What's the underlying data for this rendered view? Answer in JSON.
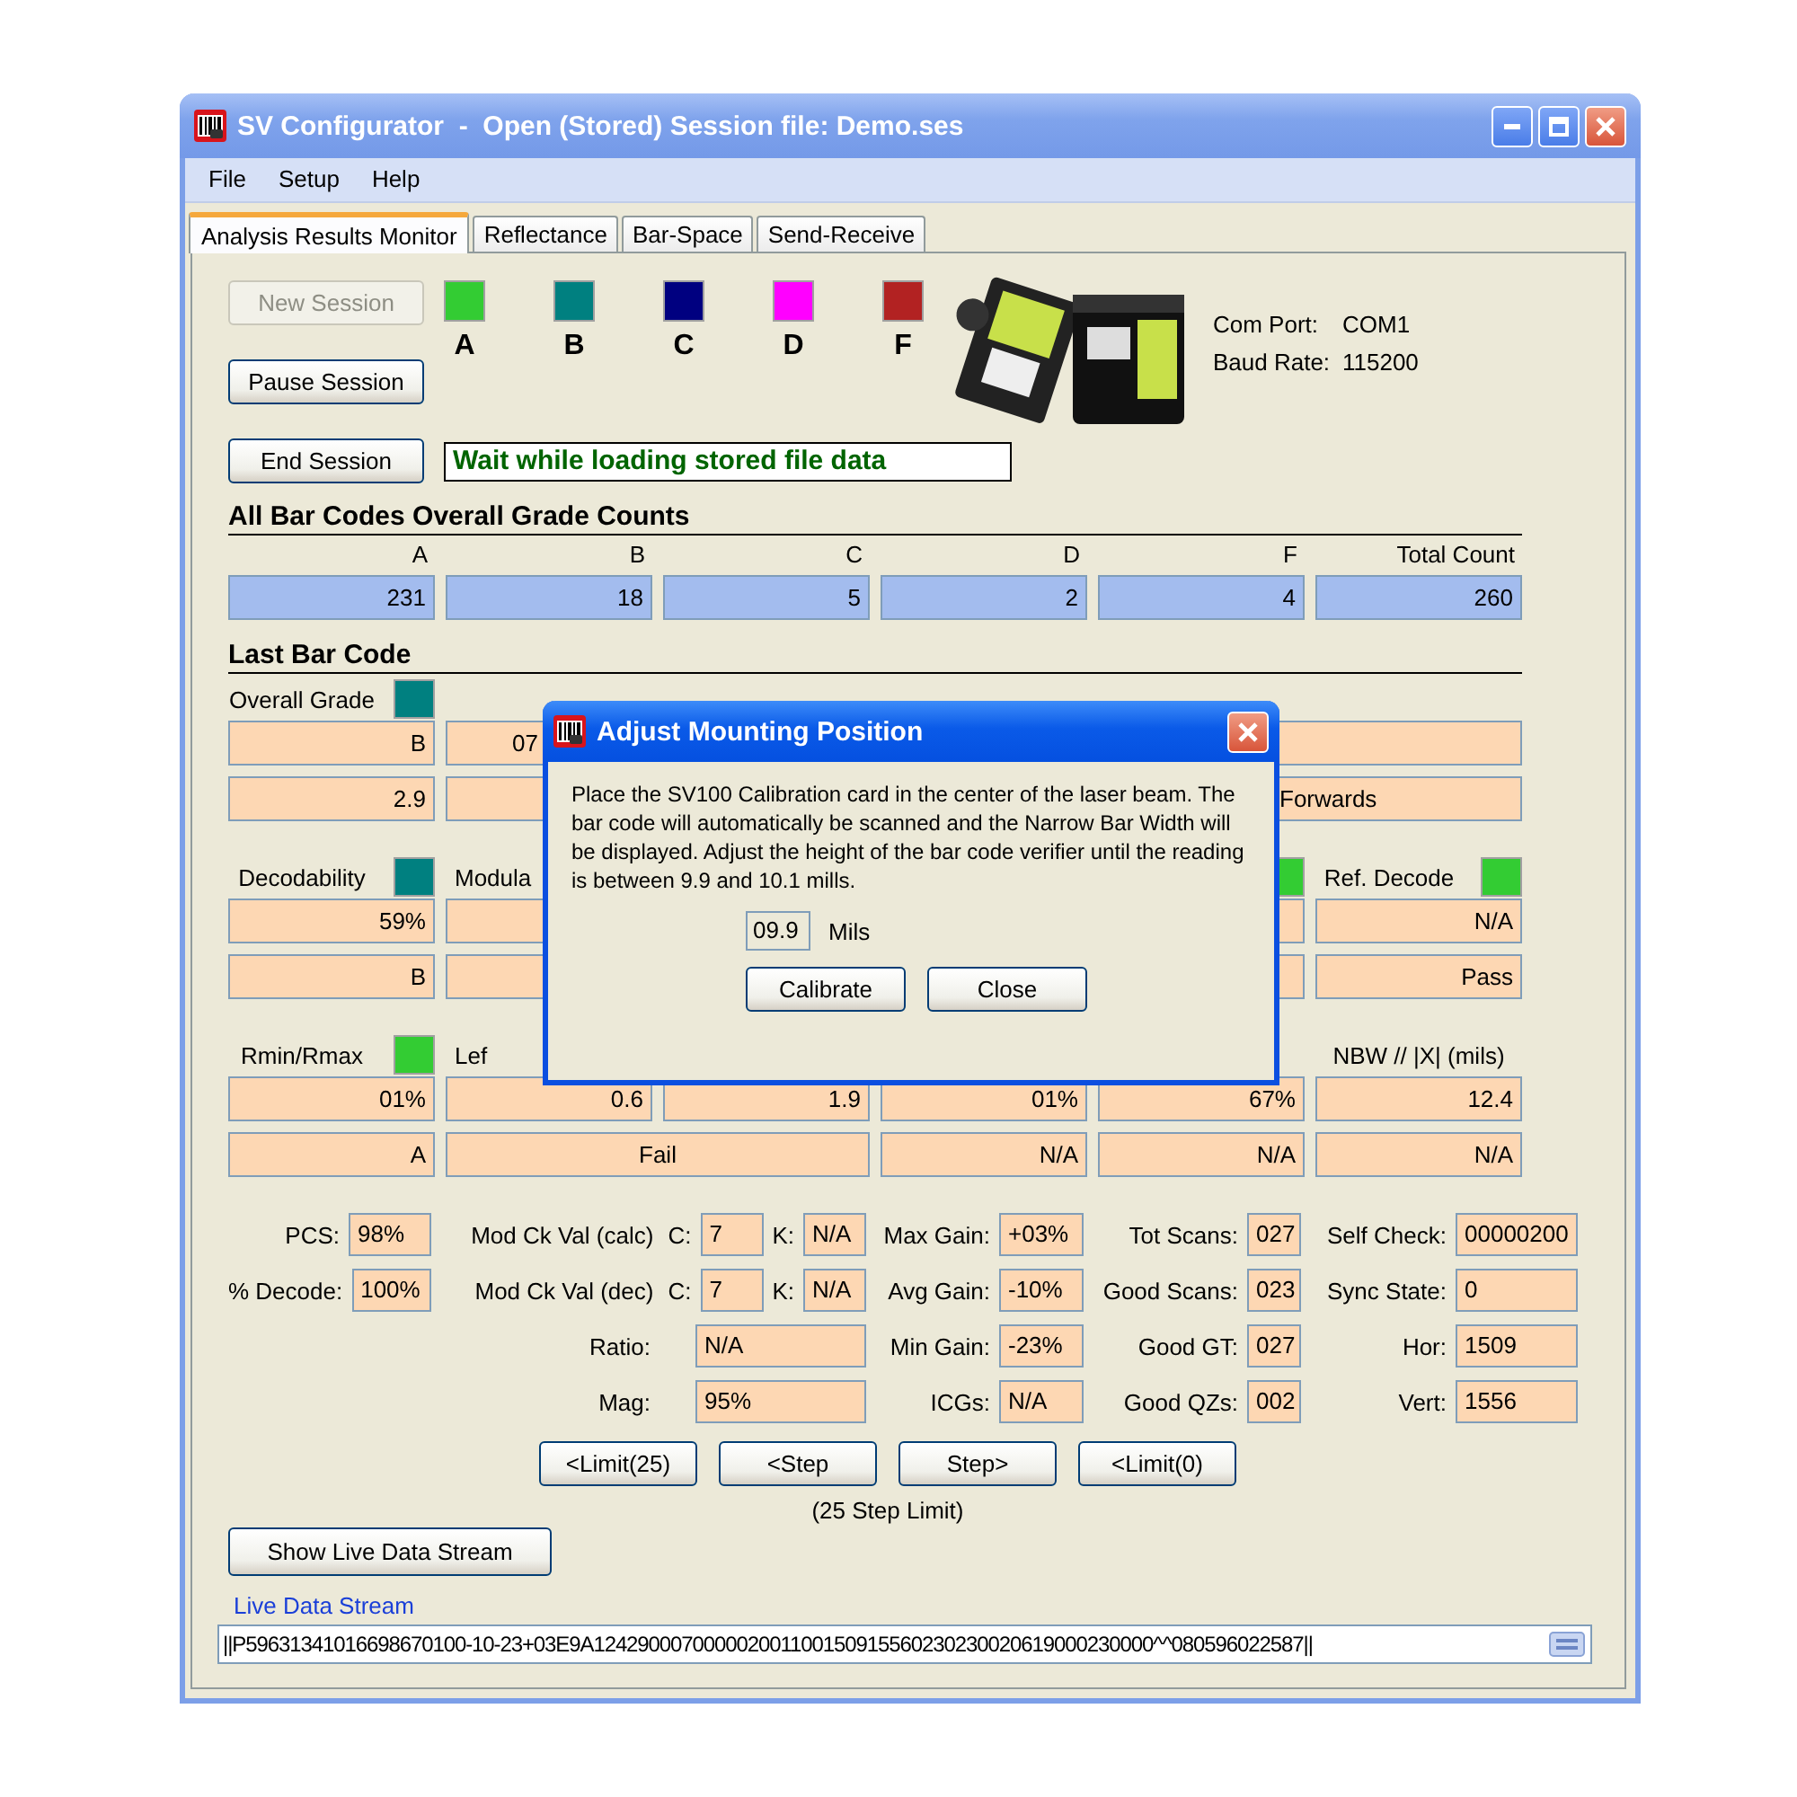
{
  "window": {
    "title": "SV Configurator  -  Open (Stored) Session file: Demo.ses"
  },
  "menu": [
    "File",
    "Setup",
    "Help"
  ],
  "tabs": [
    {
      "label": "Analysis Results Monitor",
      "selected": true
    },
    {
      "label": "Reflectance",
      "selected": false
    },
    {
      "label": "Bar-Space",
      "selected": false
    },
    {
      "label": "Send-Receive",
      "selected": false
    }
  ],
  "session": {
    "buttons": [
      {
        "label": "New Session",
        "disabled": true
      },
      {
        "label": "Pause Session",
        "disabled": false
      },
      {
        "label": "End Session",
        "disabled": false
      }
    ],
    "status": "Wait while loading stored file data"
  },
  "grade_legend": [
    {
      "label": "A",
      "color": "#33cc33"
    },
    {
      "label": "B",
      "color": "#008080"
    },
    {
      "label": "C",
      "color": "#000080"
    },
    {
      "label": "D",
      "color": "#ff00ff"
    },
    {
      "label": "F",
      "color": "#b22222"
    }
  ],
  "connection": [
    {
      "label": "Com Port:",
      "value": "COM1"
    },
    {
      "label": "Baud Rate:",
      "value": "115200"
    }
  ],
  "grade_counts": {
    "title": "All Bar Codes Overall Grade Counts",
    "columns": [
      {
        "label": "A",
        "value": "231"
      },
      {
        "label": "B",
        "value": "18"
      },
      {
        "label": "C",
        "value": "5"
      },
      {
        "label": "D",
        "value": "2"
      },
      {
        "label": "F",
        "value": "4"
      },
      {
        "label": "Total Count",
        "value": "260"
      }
    ]
  },
  "last_bar_code": {
    "title": "Last Bar Code",
    "groups": [
      {
        "headers": [
          {
            "label": "Overall Grade",
            "color": "#008080"
          },
          {
            "kind": "blank"
          },
          {
            "kind": "blank"
          },
          {
            "kind": "blank"
          },
          {
            "kind": "blank"
          },
          {
            "kind": "blank"
          }
        ],
        "rows": [
          [
            {
              "kind": "num",
              "value": "B"
            },
            {
              "kind": "clip",
              "value": "07"
            },
            {
              "kind": "blank"
            },
            {
              "kind": "blank"
            },
            {
              "kind": "wide"
            },
            {
              "kind": "merged"
            }
          ],
          [
            {
              "kind": "num",
              "value": "2.9"
            },
            {
              "kind": "blank"
            },
            {
              "kind": "blank"
            },
            {
              "kind": "blank"
            },
            {
              "kind": "wide_clip",
              "value": "Forwards"
            },
            {
              "kind": "merged"
            }
          ]
        ]
      },
      {
        "headers": [
          {
            "label": "Decodability",
            "color": "#008080"
          },
          {
            "label": "Modula",
            "kind": "clip"
          },
          {
            "kind": "blank"
          },
          {
            "kind": "blank"
          },
          {
            "color": "#33cc33"
          },
          {
            "label": "Ref. Decode",
            "color": "#33cc33"
          }
        ],
        "rows": [
          [
            {
              "kind": "num",
              "value": "59%"
            },
            {
              "kind": "blank"
            },
            {
              "kind": "blank"
            },
            {
              "kind": "blank"
            },
            {
              "kind": "blank"
            },
            {
              "kind": "num",
              "value": "N/A"
            }
          ],
          [
            {
              "kind": "num",
              "value": "B"
            },
            {
              "kind": "blank"
            },
            {
              "kind": "blank"
            },
            {
              "kind": "blank"
            },
            {
              "kind": "blank"
            },
            {
              "kind": "num",
              "value": "Pass"
            }
          ]
        ]
      },
      {
        "headers": [
          {
            "label": "Rmin/Rmax",
            "color": "#33cc33"
          },
          {
            "label": "Lef",
            "kind": "clip"
          },
          {
            "kind": "blank"
          },
          {
            "kind": "blank"
          },
          {
            "kind": "blank"
          },
          {
            "label": "NBW // |X| (mils)"
          }
        ],
        "rows": [
          [
            {
              "kind": "num",
              "value": "01%"
            },
            {
              "kind": "num",
              "value": "0.6"
            },
            {
              "kind": "num",
              "value": "1.9"
            },
            {
              "kind": "num",
              "value": "01%"
            },
            {
              "kind": "num",
              "value": "67%"
            },
            {
              "kind": "num",
              "value": "12.4"
            }
          ],
          [
            {
              "kind": "num",
              "value": "A"
            },
            {
              "kind": "wide",
              "value": "Fail"
            },
            {
              "kind": "merged"
            },
            {
              "kind": "num",
              "value": "N/A"
            },
            {
              "kind": "num",
              "value": "N/A"
            },
            {
              "kind": "num",
              "value": "N/A"
            }
          ]
        ]
      }
    ]
  },
  "stats": [
    [
      {
        "label": "PCS:",
        "value": "98%"
      },
      {
        "kind": "check",
        "label": "Mod Ck Val (calc)",
        "c_label": "C:",
        "c_value": "7",
        "k_label": "K:",
        "k_value": "N/A"
      },
      {
        "label": "Max Gain:",
        "value": "+03%"
      },
      {
        "label": "Tot Scans:",
        "value": "027"
      },
      {
        "label": "Self Check:",
        "value": "00000200"
      }
    ],
    [
      {
        "label": "% Decode:",
        "value": "100%"
      },
      {
        "kind": "check",
        "label": "Mod Ck Val (dec)",
        "c_label": "C:",
        "c_value": "7",
        "k_label": "K:",
        "k_value": "N/A"
      },
      {
        "label": "Avg Gain:",
        "value": "-10%"
      },
      {
        "label": "Good Scans:",
        "value": "023"
      },
      {
        "label": "Sync State:",
        "value": "0"
      }
    ],
    [
      {
        "kind": "blank"
      },
      {
        "label": "Ratio:",
        "value": "N/A"
      },
      {
        "label": "Min Gain:",
        "value": "-23%"
      },
      {
        "label": "Good GT:",
        "value": "027"
      },
      {
        "label": "Hor:",
        "value": "1509"
      }
    ],
    [
      {
        "kind": "blank"
      },
      {
        "label": "Mag:",
        "value": "95%"
      },
      {
        "label": "ICGs:",
        "value": "N/A"
      },
      {
        "label": "Good QZs:",
        "value": "002"
      },
      {
        "label": "Vert:",
        "value": "1556"
      }
    ]
  ],
  "step_buttons": [
    "<Limit(25)",
    "<Step",
    "Step>",
    "<Limit(0)"
  ],
  "step_note": "(25 Step Limit)",
  "live_stream": {
    "button": "Show Live Data Stream",
    "label": "Live Data Stream",
    "value": "||P59631341016698670100-10-23+03E9A124290007000002001100150915560230230020619000230000^^080596022587||"
  },
  "dialog": {
    "title": "Adjust Mounting Position",
    "message": "Place the SV100 Calibration card in the center of the laser beam. The bar code will automatically be scanned and the Narrow Bar Width will be displayed. Adjust the height of the bar code verifier until the reading is between 9.9 and 10.1 mills.",
    "reading": "09.9",
    "unit": "Mils",
    "buttons": [
      "Calibrate",
      "Close"
    ]
  }
}
